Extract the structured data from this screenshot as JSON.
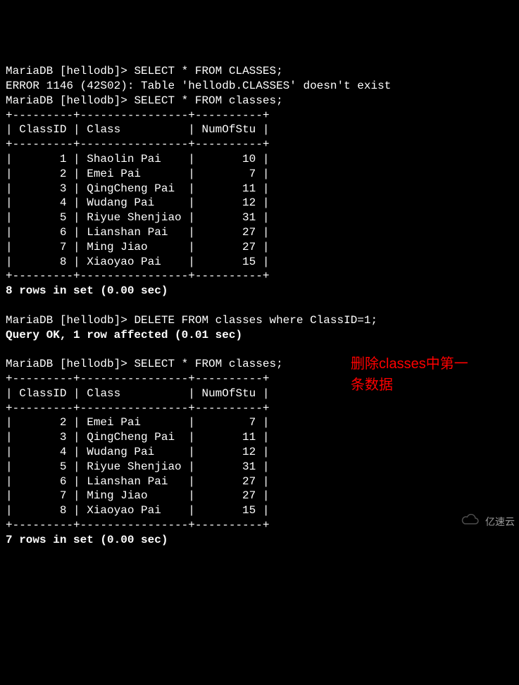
{
  "session": {
    "prompt": "MariaDB [hellodb]>",
    "queries": {
      "q1": "SELECT * FROM CLASSES;",
      "error": "ERROR 1146 (42S02): Table 'hellodb.CLASSES' doesn't exist",
      "q2": "SELECT * FROM classes;",
      "q3": "DELETE FROM classes where ClassID=1;",
      "q4": "SELECT * FROM classes;"
    },
    "result_msgs": {
      "eight_rows": "8 rows in set (0.00 sec)",
      "delete_ok": "Query OK, 1 row affected (0.01 sec)",
      "seven_rows": "7 rows in set (0.00 sec)"
    },
    "table": {
      "headers": {
        "col1": "ClassID",
        "col2": "Class",
        "col3": "NumOfStu"
      }
    },
    "table1_rows": [
      {
        "id": "1",
        "class": "Shaolin Pai",
        "num": "10"
      },
      {
        "id": "2",
        "class": "Emei Pai",
        "num": "7"
      },
      {
        "id": "3",
        "class": "QingCheng Pai",
        "num": "11"
      },
      {
        "id": "4",
        "class": "Wudang Pai",
        "num": "12"
      },
      {
        "id": "5",
        "class": "Riyue Shenjiao",
        "num": "31"
      },
      {
        "id": "6",
        "class": "Lianshan Pai",
        "num": "27"
      },
      {
        "id": "7",
        "class": "Ming Jiao",
        "num": "27"
      },
      {
        "id": "8",
        "class": "Xiaoyao Pai",
        "num": "15"
      }
    ],
    "table2_rows": [
      {
        "id": "2",
        "class": "Emei Pai",
        "num": "7"
      },
      {
        "id": "3",
        "class": "QingCheng Pai",
        "num": "11"
      },
      {
        "id": "4",
        "class": "Wudang Pai",
        "num": "12"
      },
      {
        "id": "5",
        "class": "Riyue Shenjiao",
        "num": "31"
      },
      {
        "id": "6",
        "class": "Lianshan Pai",
        "num": "27"
      },
      {
        "id": "7",
        "class": "Ming Jiao",
        "num": "27"
      },
      {
        "id": "8",
        "class": "Xiaoyao Pai",
        "num": "15"
      }
    ]
  },
  "border": {
    "divider": "+---------+----------------+----------+"
  },
  "annotation": {
    "line1": "删除classes中第一",
    "line2": "条数据"
  },
  "watermark": {
    "text": "亿速云"
  }
}
